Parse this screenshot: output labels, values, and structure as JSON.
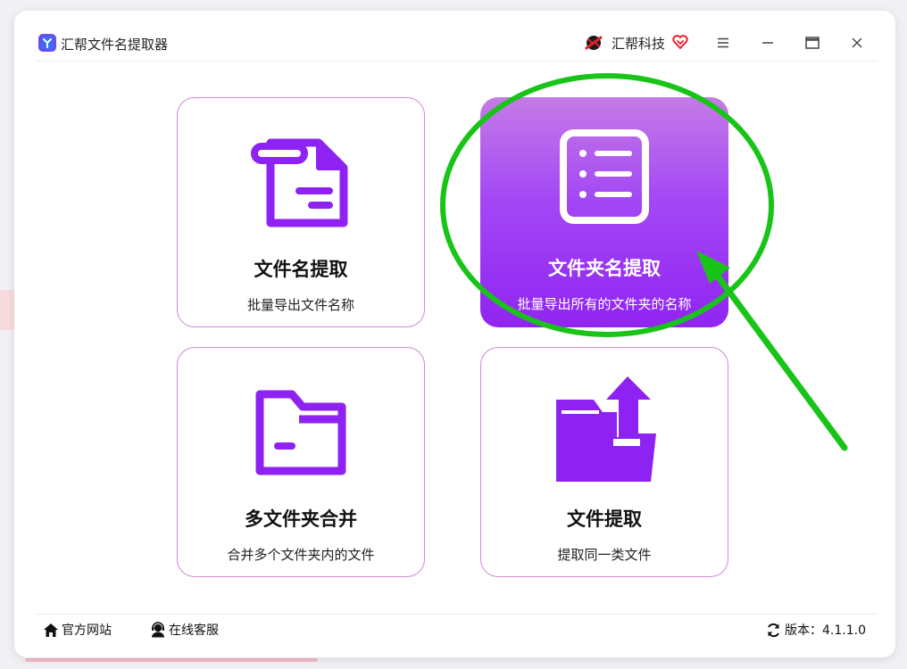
{
  "app": {
    "title": "汇帮文件名提取器"
  },
  "brand": {
    "name": "汇帮科技"
  },
  "window_controls": [
    "menu-icon",
    "minimize-icon",
    "maximize-icon",
    "close-icon"
  ],
  "cards": [
    {
      "title": "文件名提取",
      "subtitle": "批量导出文件名称",
      "icon": "file-icon",
      "active": false
    },
    {
      "title": "文件夹名提取",
      "subtitle": "批量导出所有的文件夹的名称",
      "icon": "list-icon",
      "active": true
    },
    {
      "title": "多文件夹合并",
      "subtitle": "合并多个文件夹内的文件",
      "icon": "folder-icon",
      "active": false
    },
    {
      "title": "文件提取",
      "subtitle": "提取同一类文件",
      "icon": "folder-export-icon",
      "active": false
    }
  ],
  "footer": {
    "website_label": "官方网站",
    "support_label": "在线客服",
    "version_label": "版本：",
    "version_value": "4.1.1.0"
  },
  "colors": {
    "accent": "#9124f2",
    "card_border": "#cf8ad8",
    "annotation": "#18c418"
  }
}
